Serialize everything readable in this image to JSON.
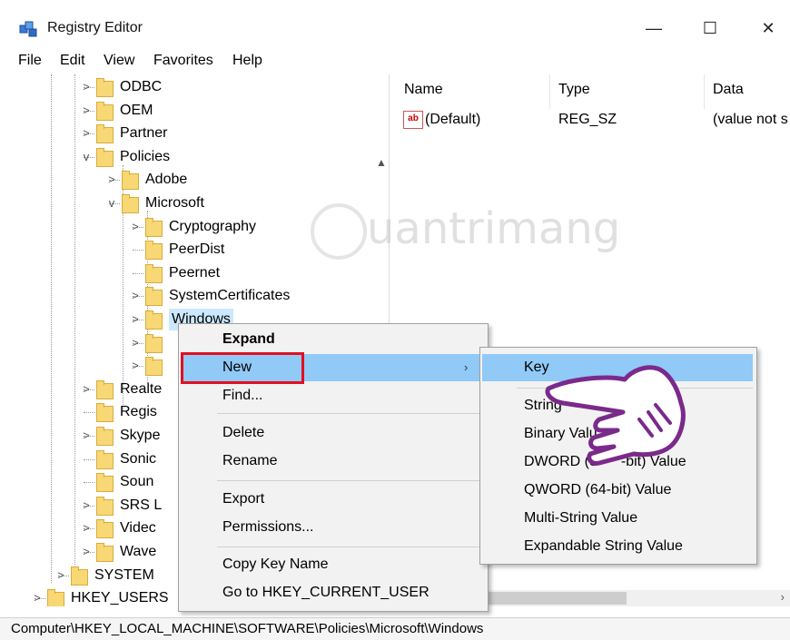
{
  "window": {
    "title": "Registry Editor",
    "minimize": "—",
    "maximize": "☐",
    "close": "✕"
  },
  "menu": [
    "File",
    "Edit",
    "View",
    "Favorites",
    "Help"
  ],
  "tree": {
    "items": [
      {
        "label": "ODBC",
        "expander": ">"
      },
      {
        "label": "OEM",
        "expander": ">"
      },
      {
        "label": "Partner",
        "expander": ">"
      },
      {
        "label": "Policies",
        "expander": "v"
      },
      {
        "label": "Adobe",
        "expander": ">"
      },
      {
        "label": "Microsoft",
        "expander": "v"
      },
      {
        "label": "Cryptography",
        "expander": ">"
      },
      {
        "label": "PeerDist",
        "expander": ""
      },
      {
        "label": "Peernet",
        "expander": ""
      },
      {
        "label": "SystemCertificates",
        "expander": ">"
      },
      {
        "label": "Windows",
        "expander": ">"
      },
      {
        "label": "",
        "expander": ">"
      },
      {
        "label": "",
        "expander": ">"
      },
      {
        "label": "Realte",
        "expander": ">"
      },
      {
        "label": "Regis",
        "expander": ""
      },
      {
        "label": "Skype",
        "expander": ">"
      },
      {
        "label": "Sonic",
        "expander": ""
      },
      {
        "label": "Soun",
        "expander": ""
      },
      {
        "label": "SRS L",
        "expander": ">"
      },
      {
        "label": "Videc",
        "expander": ">"
      },
      {
        "label": "Wave",
        "expander": ">"
      },
      {
        "label": "SYSTEM",
        "expander": ">"
      },
      {
        "label": "HKEY_USERS",
        "expander": ">"
      }
    ]
  },
  "values_pane": {
    "headers": {
      "name": "Name",
      "type": "Type",
      "data": "Data"
    },
    "rows": [
      {
        "icon": "ab",
        "name": "(Default)",
        "type": "REG_SZ",
        "data": "(value not s"
      }
    ]
  },
  "watermark": {
    "text": "uantrimang"
  },
  "context_menu": {
    "items": [
      "Expand",
      "New",
      "Find...",
      "Delete",
      "Rename",
      "Export",
      "Permissions...",
      "Copy Key Name",
      "Go to HKEY_CURRENT_USER"
    ],
    "submenu_arrow": "›"
  },
  "submenu": {
    "items": [
      "Key",
      "String",
      "Binary Valu",
      "DWORD (3",
      "-bit) Value",
      "QWORD (64-bit) Value",
      "Multi-String Value",
      "Expandable String Value"
    ]
  },
  "status": {
    "path": "Computer\\HKEY_LOCAL_MACHINE\\SOFTWARE\\Policies\\Microsoft\\Windows"
  },
  "colors": {
    "highlight": "#91c9f7",
    "red_outline": "#e01020",
    "hand_outline": "#7a2a8a"
  }
}
